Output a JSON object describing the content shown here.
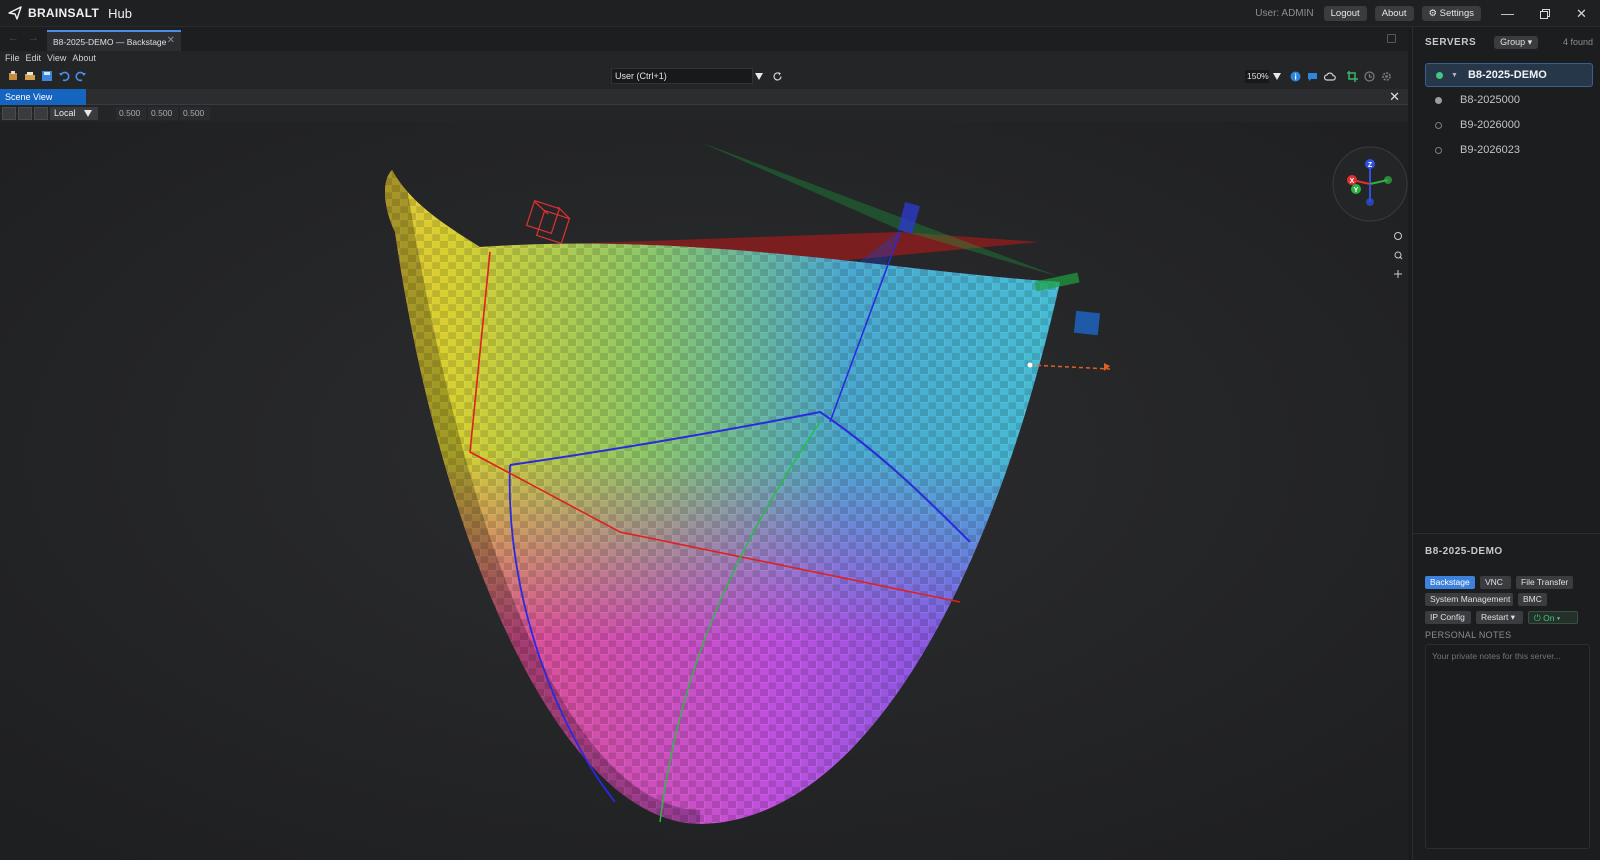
{
  "app": {
    "brand": "BRAINSALT",
    "hub": "Hub"
  },
  "titlebar": {
    "user": "User: ADMIN",
    "logout": "Logout",
    "about": "About",
    "settings": "⚙ Settings"
  },
  "tab": {
    "label": "B8-2025-DEMO — Backstage"
  },
  "menu": [
    "File",
    "Edit",
    "View",
    "About"
  ],
  "toolbar": {
    "user_select": "User  (Ctrl+1)",
    "zoom": "150%"
  },
  "scene": {
    "title": "Scene View",
    "space": "Local",
    "values": [
      "0.500",
      "0.500",
      "0.500"
    ]
  },
  "gizmo": {
    "z": "Z",
    "x": "X",
    "y": "Y"
  },
  "sidebar": {
    "title": "SERVERS",
    "group": "Group ▾",
    "found": "4 found",
    "servers": [
      {
        "name": "B8-2025-DEMO",
        "status": "online"
      },
      {
        "name": "B8-2025000",
        "status": "idle"
      },
      {
        "name": "B9-2026000",
        "status": "offline"
      },
      {
        "name": "B9-2026023",
        "status": "offline"
      }
    ]
  },
  "detail": {
    "title": "B8-2025-DEMO",
    "actions": [
      "Backstage",
      "VNC",
      "File Transfer",
      "System Management",
      "BMC",
      "IP Config",
      "Restart ▾",
      "⏻ On ▾"
    ],
    "notes_label": "PERSONAL NOTES",
    "notes_placeholder": "Your private notes for this server..."
  },
  "colors": {
    "accent": "#3c82dc",
    "online": "#43c77a",
    "scene_tab": "#1565c0"
  }
}
